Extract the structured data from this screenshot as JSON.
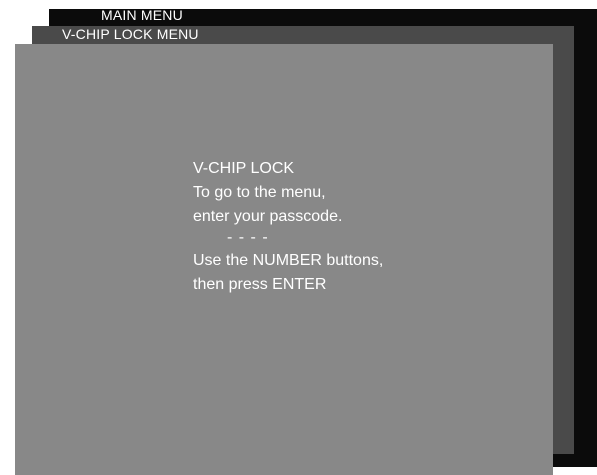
{
  "menus": {
    "main_menu_title": "MAIN MENU",
    "vchip_lock_menu_title": "V-CHIP LOCK MENU"
  },
  "dialog": {
    "heading": "V-CHIP LOCK",
    "line1": "To go to the menu,",
    "line2": "enter your passcode.",
    "passcode_value": "- - - -",
    "instruction1": "Use the NUMBER buttons,",
    "instruction2": "then press ENTER"
  },
  "colors": {
    "main_menu_panel": "#0b0b0b",
    "vchip_menu_panel": "#4a4a4a",
    "dialog_panel": "#888888",
    "text": "#ffffff"
  }
}
